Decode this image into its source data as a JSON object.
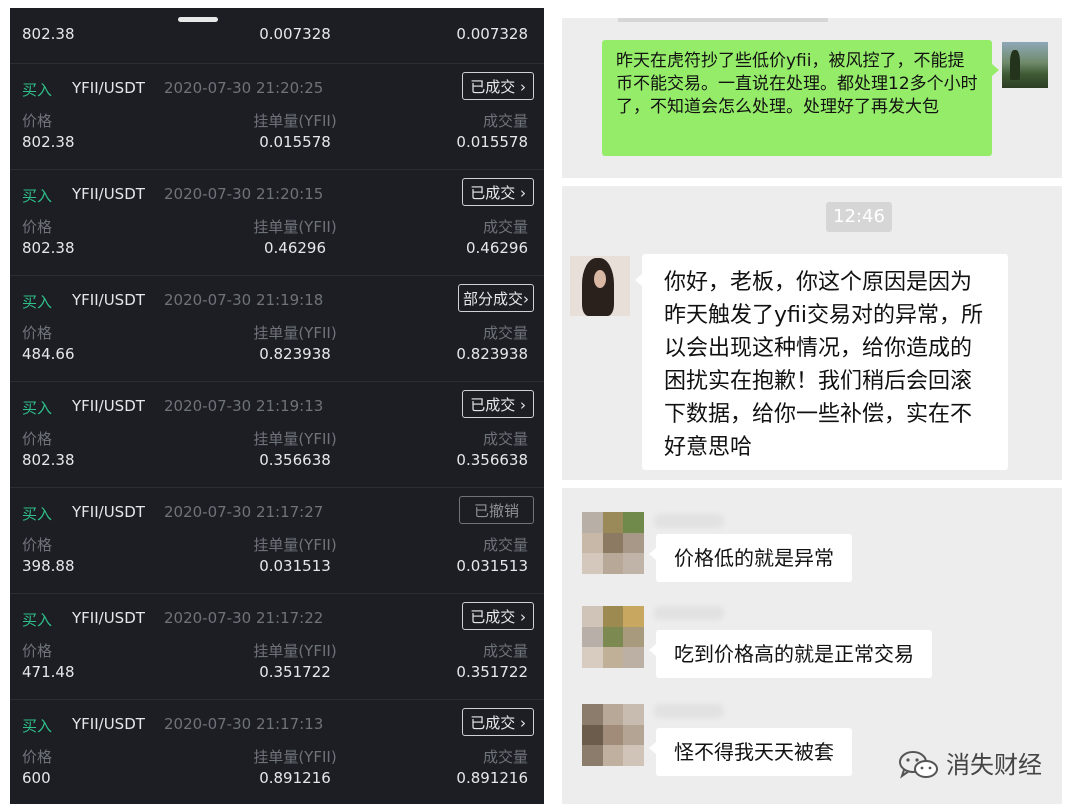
{
  "trade_panel": {
    "first_row": {
      "price": "802.38",
      "amount": "0.007328",
      "filled": "0.007328"
    },
    "labels": {
      "price": "价格",
      "amount": "挂单量(YFII)",
      "filled": "成交量"
    },
    "orders": [
      {
        "side": "买入",
        "pair": "YFII/USDT",
        "time": "2020-07-30 21:20:25",
        "status": "已成交",
        "price": "802.38",
        "amount": "0.015578",
        "filled": "0.015578"
      },
      {
        "side": "买入",
        "pair": "YFII/USDT",
        "time": "2020-07-30 21:20:15",
        "status": "已成交",
        "price": "802.38",
        "amount": "0.46296",
        "filled": "0.46296"
      },
      {
        "side": "买入",
        "pair": "YFII/USDT",
        "time": "2020-07-30 21:19:18",
        "status": "部分成交",
        "price": "484.66",
        "amount": "0.823938",
        "filled": "0.823938"
      },
      {
        "side": "买入",
        "pair": "YFII/USDT",
        "time": "2020-07-30 21:19:13",
        "status": "已成交",
        "price": "802.38",
        "amount": "0.356638",
        "filled": "0.356638"
      },
      {
        "side": "买入",
        "pair": "YFII/USDT",
        "time": "2020-07-30 21:17:27",
        "status": "已撤销",
        "price": "398.88",
        "amount": "0.031513",
        "filled": "0.031513"
      },
      {
        "side": "买入",
        "pair": "YFII/USDT",
        "time": "2020-07-30 21:17:22",
        "status": "已成交",
        "price": "471.48",
        "amount": "0.351722",
        "filled": "0.351722"
      },
      {
        "side": "买入",
        "pair": "YFII/USDT",
        "time": "2020-07-30 21:17:13",
        "status": "已成交",
        "price": "600",
        "amount": "0.891216",
        "filled": "0.891216"
      }
    ],
    "chevron_icon": "chevron-right-icon",
    "colors": {
      "background": "#1c1e23",
      "buy": "#2fbf8a",
      "muted": "#6e7279"
    }
  },
  "chat": {
    "complaint": "昨天在虎符抄了些低价yfii，被风控了，不能提币不能交易。一直说在处理。都处理12多个小时了，不知道会怎么处理。处理好了再发大包",
    "timestamp": "12:46",
    "reply": "你好，老板，你这个原因是因为昨天触发了yfii交易对的异常，所以会出现这种情况，给你造成的困扰实在抱歉！我们稍后会回滚下数据，给你一些补偿，实在不好意思哈",
    "group_messages": [
      "价格低的就是异常",
      "吃到价格高的就是正常交易",
      "怪不得我天天被套"
    ],
    "colors": {
      "green_bubble": "#95ec69",
      "panel_bg": "#ededed"
    }
  },
  "watermark": {
    "text": "消失财经",
    "icon": "wechat-official-account-icon"
  }
}
